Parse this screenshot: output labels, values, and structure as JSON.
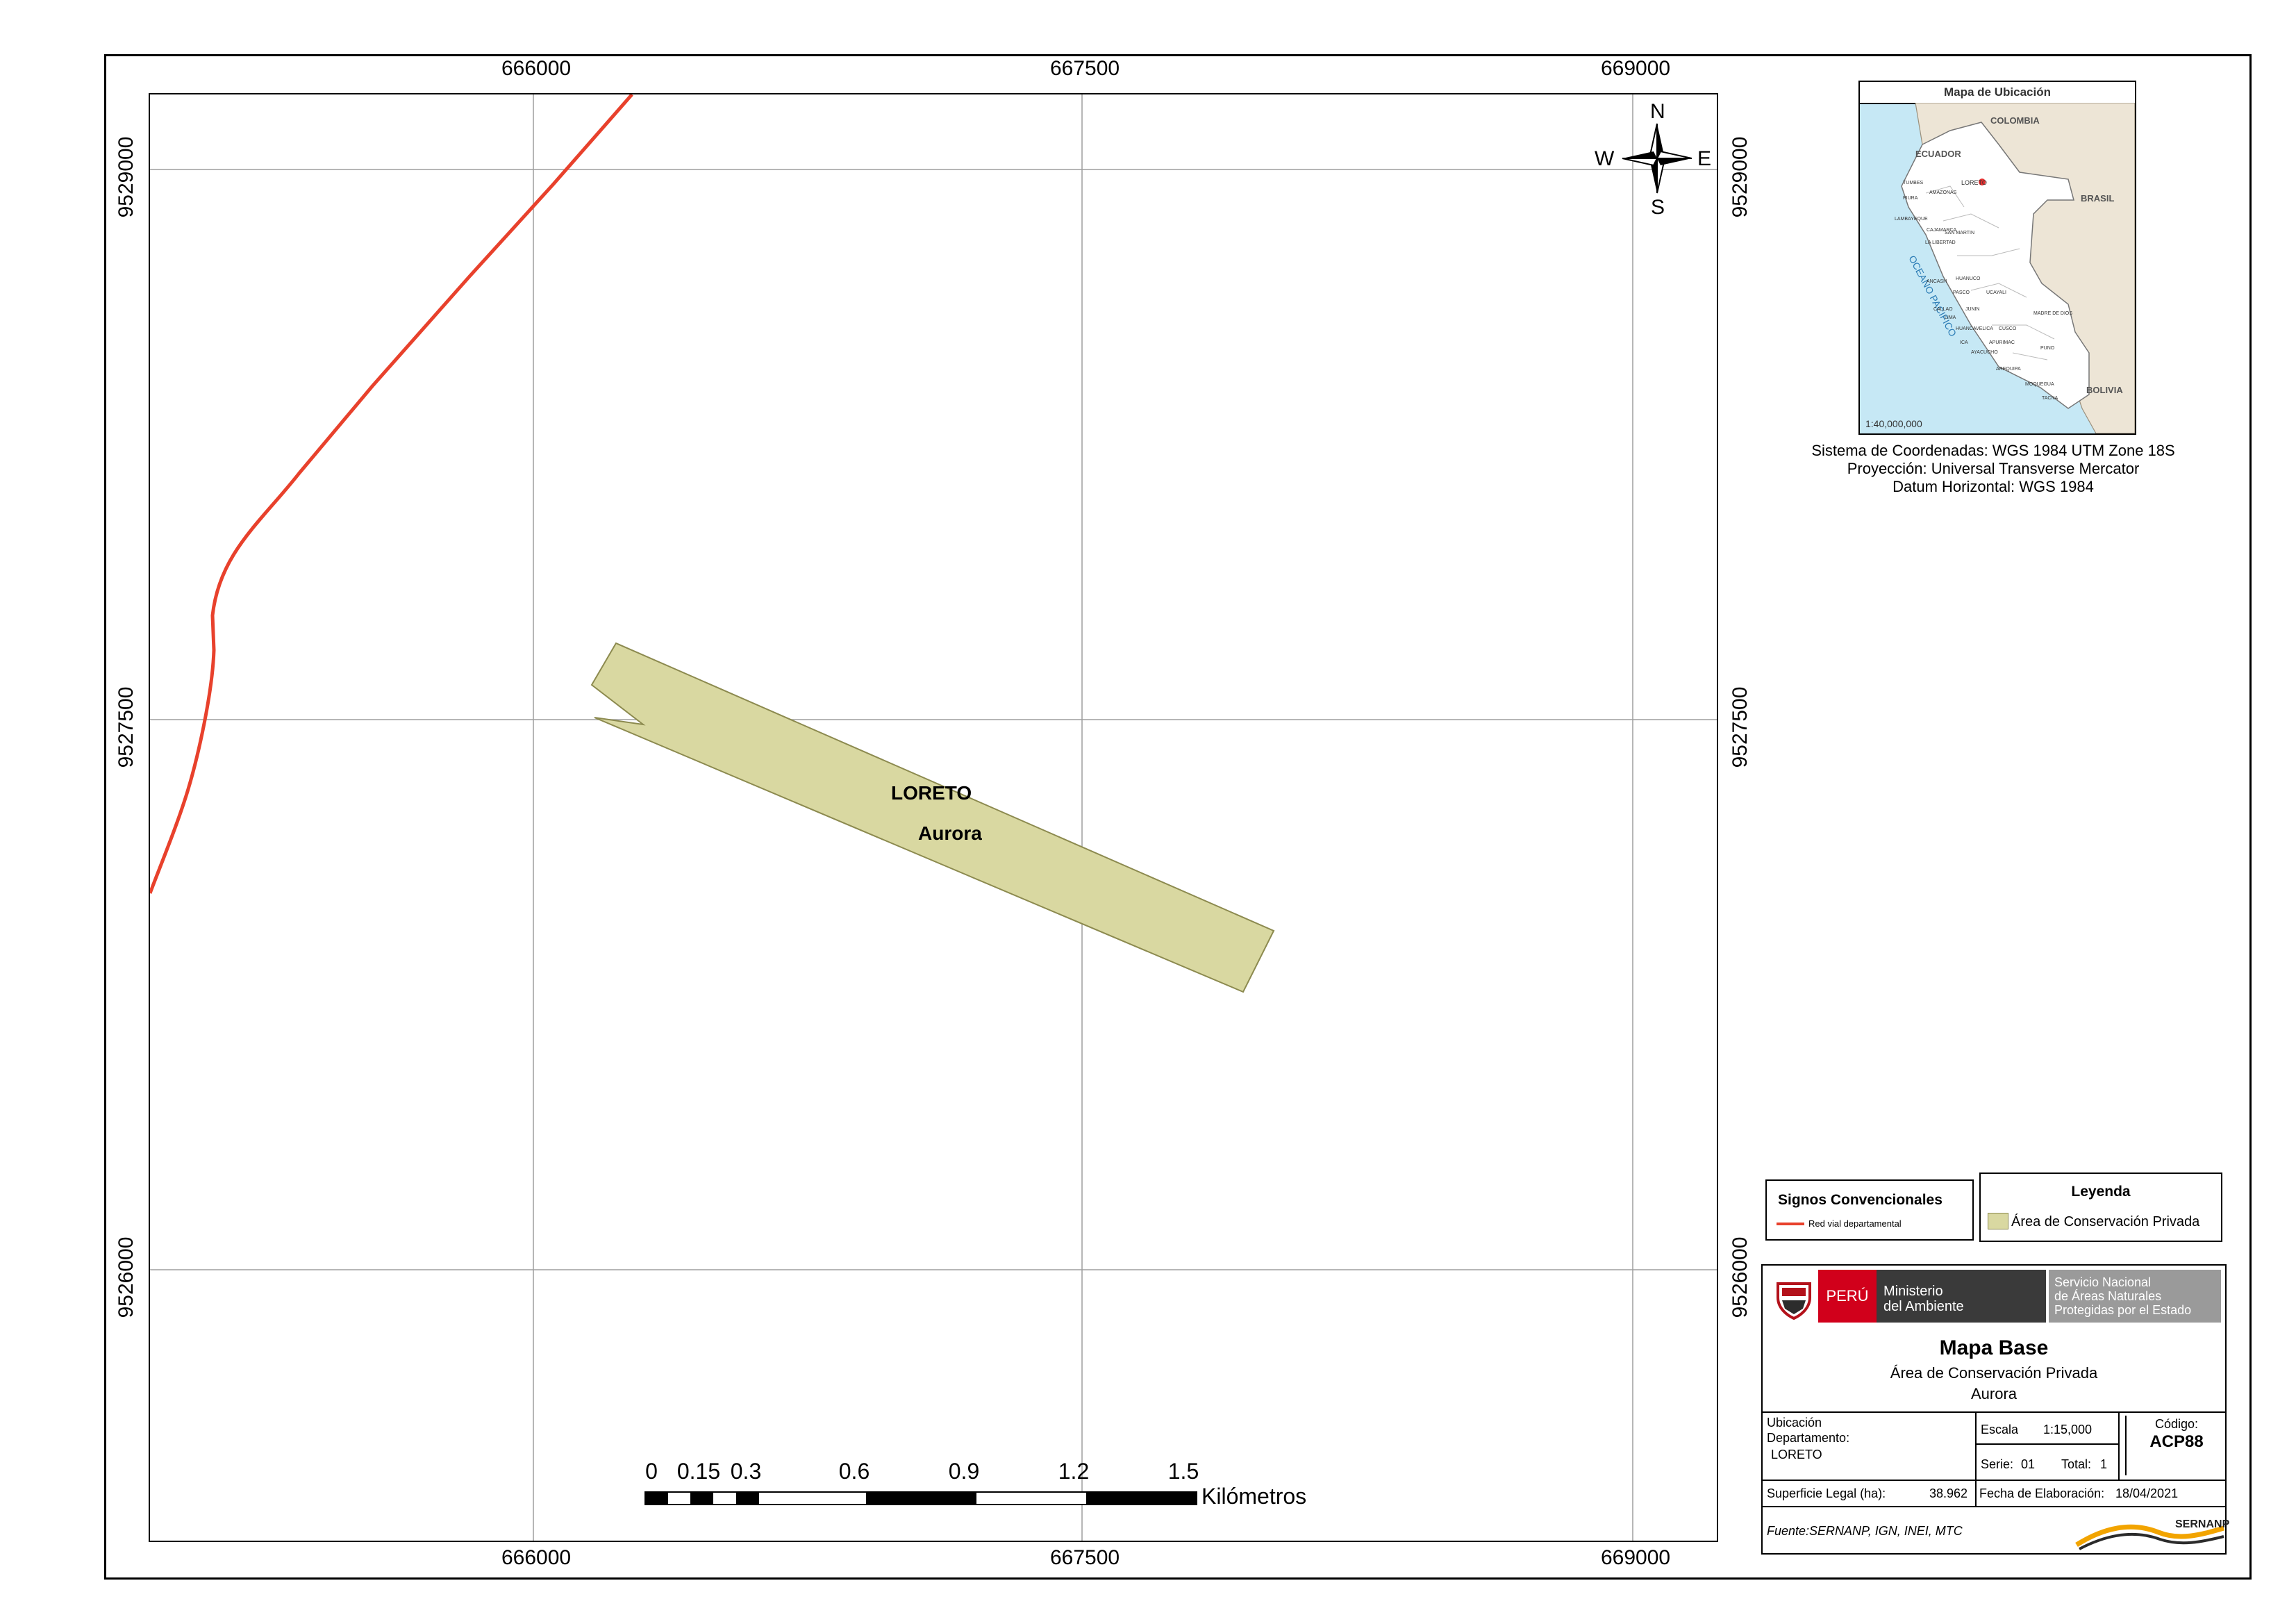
{
  "map": {
    "x_ticks_top": [
      "666000",
      "667500",
      "669000"
    ],
    "x_ticks_bottom": [
      "666000",
      "667500",
      "669000"
    ],
    "y_ticks_left": [
      "9529000",
      "9527500",
      "9526000"
    ],
    "y_ticks_right": [
      "9529000",
      "9527500",
      "9526000"
    ],
    "department_label": "LORETO",
    "area_label": "Aurora",
    "compass": {
      "n": "N",
      "s": "S",
      "e": "E",
      "w": "W"
    },
    "colors": {
      "road": "#e8412c",
      "area_fill": "#d9d8a1",
      "area_stroke": "#8c8a4f",
      "grid": "#9e9e9e"
    }
  },
  "scalebar": {
    "labels": [
      "0",
      "0.15",
      "0.3",
      "0.6",
      "0.9",
      "1.2",
      "1.5"
    ],
    "unit": "Kilómetros"
  },
  "inset": {
    "title": "Mapa de Ubicación",
    "scale": "1:40,000,000",
    "countries": [
      "COLOMBIA",
      "ECUADOR",
      "BRASIL",
      "BOLIVIA"
    ],
    "ocean": "OCEANO PACIFICO",
    "marker_label": "LORETO",
    "regions": [
      "TUMBES",
      "PIURA",
      "LAMBAYEQUE",
      "CAJAMARCA",
      "LA LIBERTAD",
      "ANCASH",
      "HUANUCO",
      "PASCO",
      "LIMA",
      "CALLAO",
      "JUNIN",
      "UCAYALI",
      "MADRE DE DIOS",
      "CUSCO",
      "HUANCAVELICA",
      "ICA",
      "AYACUCHO",
      "APURIMAC",
      "AREQUIPA",
      "PUNO",
      "MOQUEGUA",
      "TACNA",
      "SAN MARTIN",
      "AMAZONAS"
    ]
  },
  "crs": {
    "line1": "Sistema de Coordenadas: WGS 1984 UTM Zone 18S",
    "line2": "Proyección: Universal Transverse Mercator",
    "line3": "Datum Horizontal: WGS 1984"
  },
  "signos": {
    "title": "Signos Convencionales",
    "road_label": "Red vial departamental"
  },
  "leyenda": {
    "title": "Leyenda",
    "area_label": "Área de Conservación Privada"
  },
  "titleblock": {
    "peru": "PERÚ",
    "ministerio_1": "Ministerio",
    "ministerio_2": "del Ambiente",
    "sernanp_1": "Servicio Nacional",
    "sernanp_2": "de Áreas Naturales",
    "sernanp_3": "Protegidas por el Estado",
    "map_title": "Mapa Base",
    "subtitle": "Área de Conservación Privada",
    "name": "Aurora",
    "ubicacion_label_1": "Ubicación",
    "ubicacion_label_2": "Departamento:",
    "ubicacion_value": "LORETO",
    "escala_label": "Escala",
    "escala_value": "1:15,000",
    "serie_label": "Serie:",
    "serie_value": "01",
    "total_label": "Total:",
    "total_value": "1",
    "codigo_label": "Código:",
    "codigo_value": "ACP88",
    "superficie_label": "Superficie Legal (ha):",
    "superficie_value": "38.962",
    "fecha_label": "Fecha de Elaboración:",
    "fecha_value": "18/04/2021",
    "fuente": "Fuente:SERNANP, IGN, INEI, MTC",
    "logo_text": "SERNANP"
  }
}
